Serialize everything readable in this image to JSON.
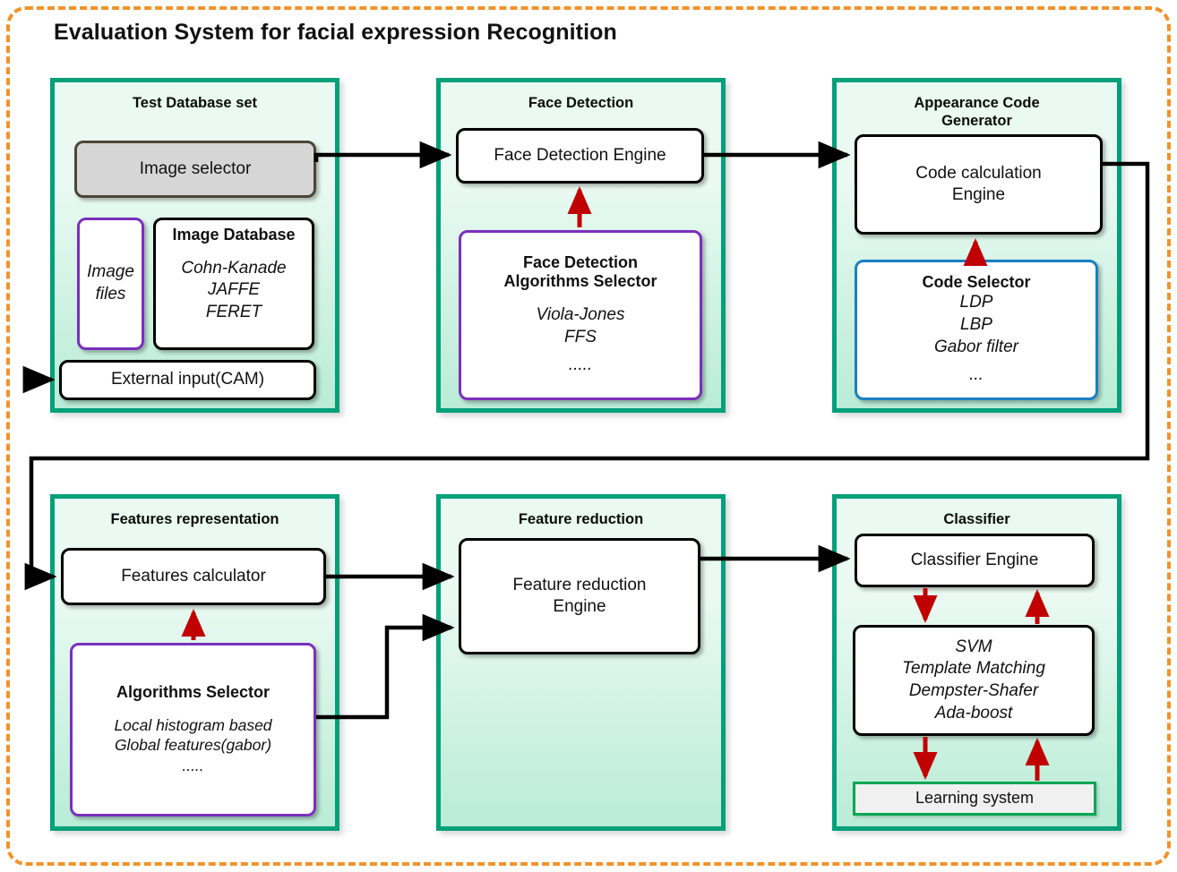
{
  "diagram": {
    "title": "Evaluation System for facial expression Recognition",
    "frame_color": "#f0932b",
    "panel_border_color": "#00a07a",
    "arrow_color": "#000000",
    "selector_arrow_color": "#c00000"
  },
  "panels": {
    "test_database": {
      "title": "Test Database set",
      "image_selector": {
        "label": "Image selector",
        "border_color": "#4d4634",
        "fill": "#d6d6d6"
      },
      "image_files": {
        "label_line1": "Image",
        "label_line2": "files",
        "border_color": "#7b2fbe"
      },
      "image_database": {
        "heading": "Image Database",
        "items": [
          "Cohn-Kanade",
          "JAFFE",
          "FERET"
        ]
      },
      "external_input": {
        "label": "External input(CAM)"
      }
    },
    "face_detection": {
      "title": "Face Detection",
      "engine": {
        "label": "Face Detection Engine"
      },
      "selector": {
        "heading_line1": "Face Detection",
        "heading_line2": "Algorithms Selector",
        "items": [
          "Viola-Jones",
          "FFS",
          "....."
        ],
        "border_color": "#7b2fbe"
      }
    },
    "appearance_code_generator": {
      "title_line1": "Appearance Code",
      "title_line2": "Generator",
      "engine": {
        "label_line1": "Code calculation",
        "label_line2": "Engine"
      },
      "code_selector": {
        "heading": "Code Selector",
        "items": [
          "LDP",
          "LBP",
          "Gabor filter",
          "..."
        ],
        "border_color": "#1a7fc1"
      }
    },
    "features_representation": {
      "title": "Features representation",
      "calculator": {
        "label": "Features calculator"
      },
      "selector": {
        "heading": "Algorithms Selector",
        "items": [
          "Local histogram based",
          "Global features(gabor)",
          "....."
        ],
        "border_color": "#7b2fbe"
      }
    },
    "feature_reduction": {
      "title": "Feature reduction",
      "engine": {
        "label_line1": "Feature reduction",
        "label_line2": "Engine"
      }
    },
    "classifier": {
      "title": "Classifier",
      "engine": {
        "label": "Classifier Engine"
      },
      "methods": {
        "items": [
          "SVM",
          "Template Matching",
          "Dempster-Shafer",
          "Ada-boost"
        ]
      },
      "learning_system": {
        "label": "Learning system",
        "border_color": "#00a651",
        "fill": "#f0f0f0"
      }
    }
  }
}
